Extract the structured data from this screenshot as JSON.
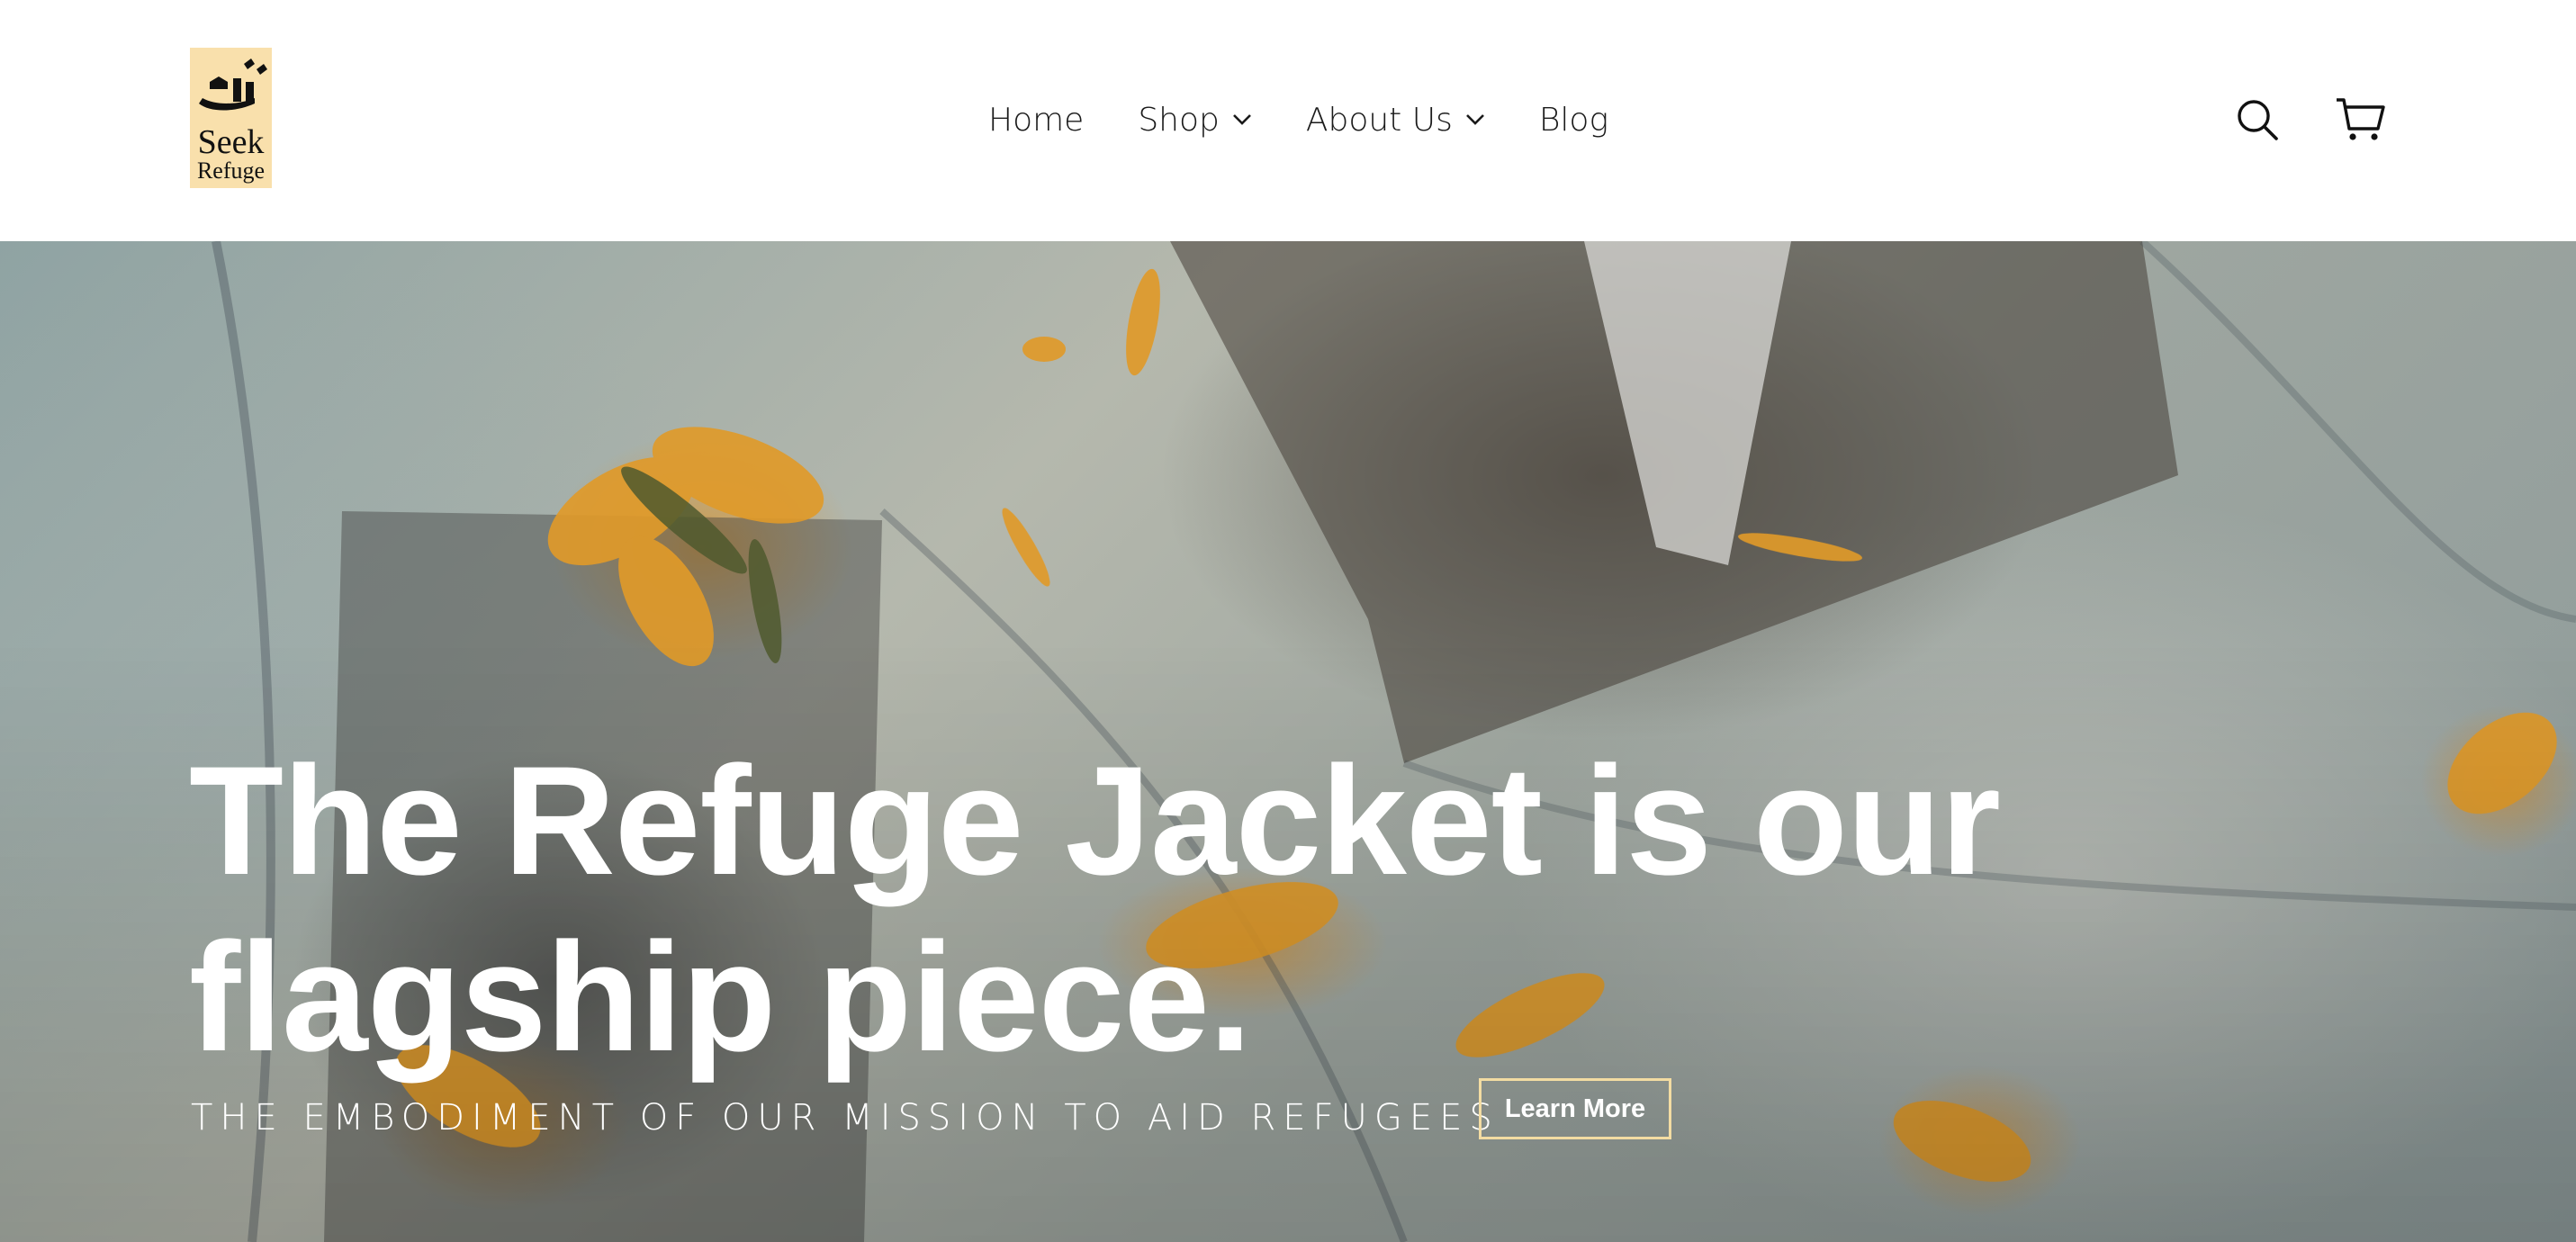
{
  "brand": {
    "logo_word1": "Seek",
    "logo_word2": "Refuge",
    "logo_bg_color": "#f9e0ac"
  },
  "nav": {
    "items": [
      {
        "label": "Home",
        "has_dropdown": false
      },
      {
        "label": "Shop",
        "has_dropdown": true
      },
      {
        "label": "About Us",
        "has_dropdown": true
      },
      {
        "label": "Blog",
        "has_dropdown": false
      }
    ]
  },
  "header_icons": [
    "search-icon",
    "cart-icon"
  ],
  "hero": {
    "title": "The Refuge Jacket is our flagship piece.",
    "subtitle": "THE EMBODIMENT OF OUR MISSION TO AID REFUGEES",
    "cta_label": "Learn More",
    "cta_border_color": "#f3dca2",
    "accent_color": "#e09a2a"
  }
}
